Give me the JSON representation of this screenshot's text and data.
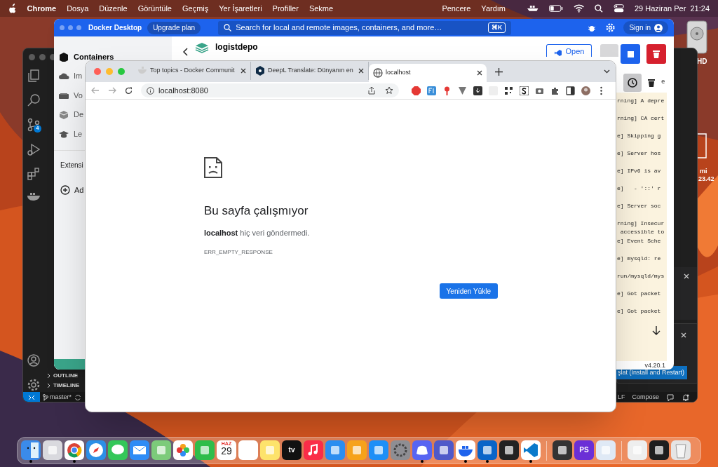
{
  "menubar": {
    "app": "Chrome",
    "menus": [
      "Dosya",
      "Düzenle",
      "Görüntüle",
      "Geçmiş",
      "Yer İşaretleri",
      "Profiller",
      "Sekme"
    ],
    "extra_menus": [
      "Pencere",
      "Yardım"
    ],
    "clock": "29 Haziran Per  21:24"
  },
  "desktop_labels": [
    "HD",
    "mi",
    "23.42"
  ],
  "vscode": {
    "scm_badge": "4",
    "sections": [
      "OUTLINE",
      "TIMELINE"
    ],
    "branch": "master*",
    "status_right": [
      "LF",
      "Compose"
    ],
    "install_button": "şlat (Install and Restart)"
  },
  "docker": {
    "title": "Docker Desktop",
    "upgrade": "Upgrade plan",
    "search_placeholder": "Search for local and remote images, containers, and more…",
    "shortcut": "⌘K",
    "sign_in": "Sign in",
    "nav": [
      {
        "label": "Containers",
        "selected": true
      },
      {
        "label": "Im",
        "selected": false
      },
      {
        "label": "Vo",
        "selected": false
      },
      {
        "label": "De",
        "selected": false
      },
      {
        "label": "Le",
        "selected": false
      }
    ],
    "extensions_heading": "Extensi",
    "add_label": "Ad",
    "container_name": "logistdepo",
    "open_button": "Open",
    "log_header_tail": "e",
    "log_lines": [
      "rning] A depre",
      "rning] CA cert",
      "e] Skipping g",
      "e] Server hos",
      "e] IPv6 is av",
      "e]   - '::' r",
      "e] Server soc",
      "rning] Insecur\n accessible to",
      "e] Event Sche",
      "e] mysqld: re",
      "run/mysqld/mys",
      "e] Got packet",
      "e] Got packet"
    ],
    "version": "v4.20.1"
  },
  "chrome": {
    "tabs": [
      {
        "title": "Top topics - Docker Communit",
        "selected": false,
        "kind": "docker"
      },
      {
        "title": "DeepL Translate: Dünyanın en",
        "selected": false,
        "kind": "deepl"
      },
      {
        "title": "localhost",
        "selected": true,
        "kind": "globe"
      }
    ],
    "url": "localhost:8080",
    "error_title": "Bu sayfa çalışmıyor",
    "error_message": "**localhost** hiç veri göndermedi.",
    "error_code": "ERR_EMPTY_RESPONSE",
    "reload_button": "Yeniden Yükle"
  },
  "dock": [
    {
      "kind": "finder",
      "running": true
    },
    {
      "kind": "launchpad",
      "running": false
    },
    {
      "kind": "chrome",
      "running": true
    },
    {
      "kind": "safari",
      "running": false
    },
    {
      "kind": "messages",
      "running": false
    },
    {
      "kind": "mail",
      "running": false
    },
    {
      "kind": "maps",
      "running": false
    },
    {
      "kind": "photos",
      "running": false
    },
    {
      "kind": "facetime",
      "running": false
    },
    {
      "kind": "calendar",
      "running": false,
      "month": "HAZ",
      "day": "29"
    },
    {
      "kind": "reminders",
      "running": false
    },
    {
      "kind": "notes",
      "running": false
    },
    {
      "kind": "tv",
      "running": false,
      "label": "tv"
    },
    {
      "kind": "music",
      "running": false
    },
    {
      "kind": "keynote",
      "running": false
    },
    {
      "kind": "pages",
      "running": false
    },
    {
      "kind": "appstore",
      "running": false
    },
    {
      "kind": "settings",
      "running": false
    },
    {
      "kind": "discord",
      "running": true
    },
    {
      "kind": "teams",
      "running": false
    },
    {
      "kind": "docker",
      "running": true
    },
    {
      "kind": "outlook",
      "running": true
    },
    {
      "kind": "terminal",
      "running": false
    },
    {
      "kind": "vscode",
      "running": true
    },
    {
      "kind": "separator"
    },
    {
      "kind": "console",
      "running": false
    },
    {
      "kind": "phpstorm",
      "running": false,
      "label": "PS"
    },
    {
      "kind": "preview",
      "running": false
    },
    {
      "kind": "separator"
    },
    {
      "kind": "file",
      "running": false
    },
    {
      "kind": "screen",
      "running": false
    },
    {
      "kind": "trash",
      "running": false
    }
  ]
}
